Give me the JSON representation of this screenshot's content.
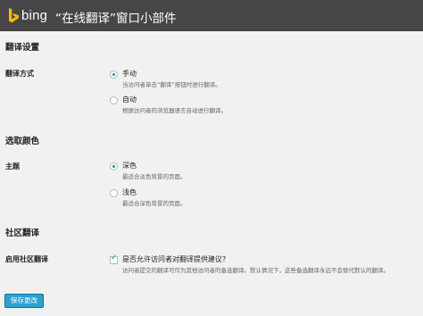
{
  "header": {
    "logo_text": "bing",
    "title": "“在线翻译”窗口小部件"
  },
  "sections": {
    "translation_settings": "翻译设置",
    "color_settings": "选取颜色",
    "community_translation": "社区翻译"
  },
  "translation_mode": {
    "label": "翻译方式",
    "options": [
      {
        "label": "手动",
        "description": "当访问者单击“翻译”按钮时进行翻译。",
        "selected": true
      },
      {
        "label": "自动",
        "description": "根据访问者的浏览器语言自动进行翻译。",
        "selected": false
      }
    ]
  },
  "theme": {
    "label": "主题",
    "options": [
      {
        "label": "深色",
        "description": "最适合淡色背景的页面。",
        "selected": true
      },
      {
        "label": "浅色",
        "description": "最适合深色背景的页面。",
        "selected": false
      }
    ]
  },
  "community": {
    "label": "启用社区翻译",
    "checkbox_label": "是否允许访问者对翻译提供建议?",
    "description": "访问者提交的翻译可作为其他访问者的备选翻译。默认情况下，这些备选翻译永远不会替代默认的翻译。",
    "checked": true
  },
  "actions": {
    "save_label": "保存更改"
  },
  "colors": {
    "header_bg": "#464646",
    "page_bg": "#f1f1f1",
    "accent": "#2ea2cc",
    "logo": "#ffb900"
  }
}
